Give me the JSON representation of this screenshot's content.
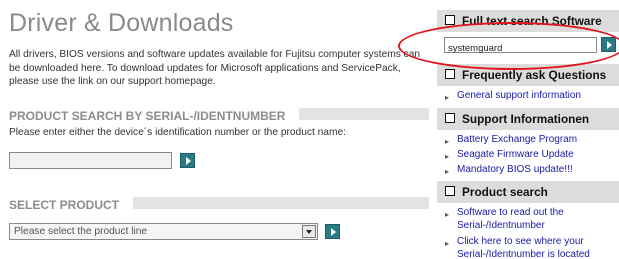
{
  "page": {
    "title": "Driver & Downloads",
    "intro": "All drivers, BIOS versions and software updates available for Fujitsu computer systems can be downloaded here. To download updates for Microsoft applications and ServicePack, please use the link on our support homepage."
  },
  "product_search": {
    "heading": "PRODUCT SEARCH BY SERIAL-/IDENTNUMBER",
    "note": "Please enter either the device´s identification number or the product name:",
    "input_value": ""
  },
  "select_product": {
    "heading": "SELECT PRODUCT",
    "selected": "Please select the product line"
  },
  "sidebar": {
    "full_text": {
      "title": "Full text search Software",
      "query": "systemguard"
    },
    "faq": {
      "title": "Frequently ask Questions",
      "links": [
        "General support information"
      ]
    },
    "support_info": {
      "title": "Support Informationen",
      "links": [
        "Battery Exchange Program",
        "Seagate Firmware Update",
        "Mandatory BIOS update!!!"
      ]
    },
    "product_search": {
      "title": "Product search",
      "links": [
        "Software to read out the Serial-/Identnumber",
        "Click here to see where your Serial-/Identnumber is located"
      ]
    }
  },
  "colors": {
    "go_button": "#2a7a86",
    "highlight": "#e0141e",
    "link": "#1a1aa6",
    "header_bg": "#dcdcdc"
  }
}
